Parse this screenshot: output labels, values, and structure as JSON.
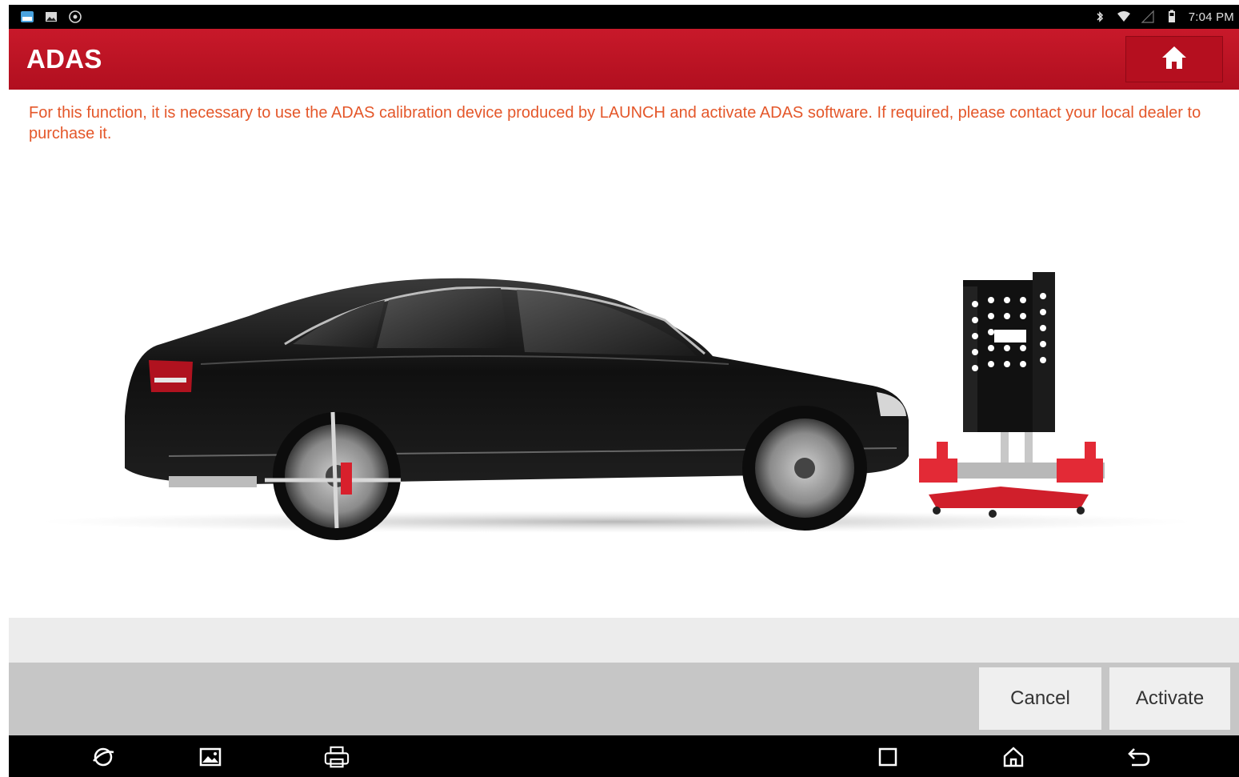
{
  "status_bar": {
    "left_icons": [
      "app-store-icon",
      "image-notification-icon",
      "settings-notification-icon"
    ],
    "right_icons": [
      "bluetooth-icon",
      "wifi-icon",
      "signal-icon",
      "battery-icon"
    ],
    "time": "7:04 PM"
  },
  "header": {
    "title": "ADAS",
    "home_icon": "home-icon",
    "color": "#c8192a"
  },
  "notice": {
    "text": "For this function, it is necessary to use the ADAS calibration device produced by LAUNCH and activate ADAS software. If required, please contact your local dealer to purchase it.",
    "color": "#e4572a"
  },
  "illustration": {
    "subject": "black sedan with ADAS calibration target frame"
  },
  "buttons": {
    "cancel": "Cancel",
    "activate": "Activate"
  },
  "nav_bar": {
    "icons": [
      "browser-icon",
      "gallery-icon",
      "printer-icon",
      "recent-apps-icon",
      "home-nav-icon",
      "back-icon"
    ]
  }
}
